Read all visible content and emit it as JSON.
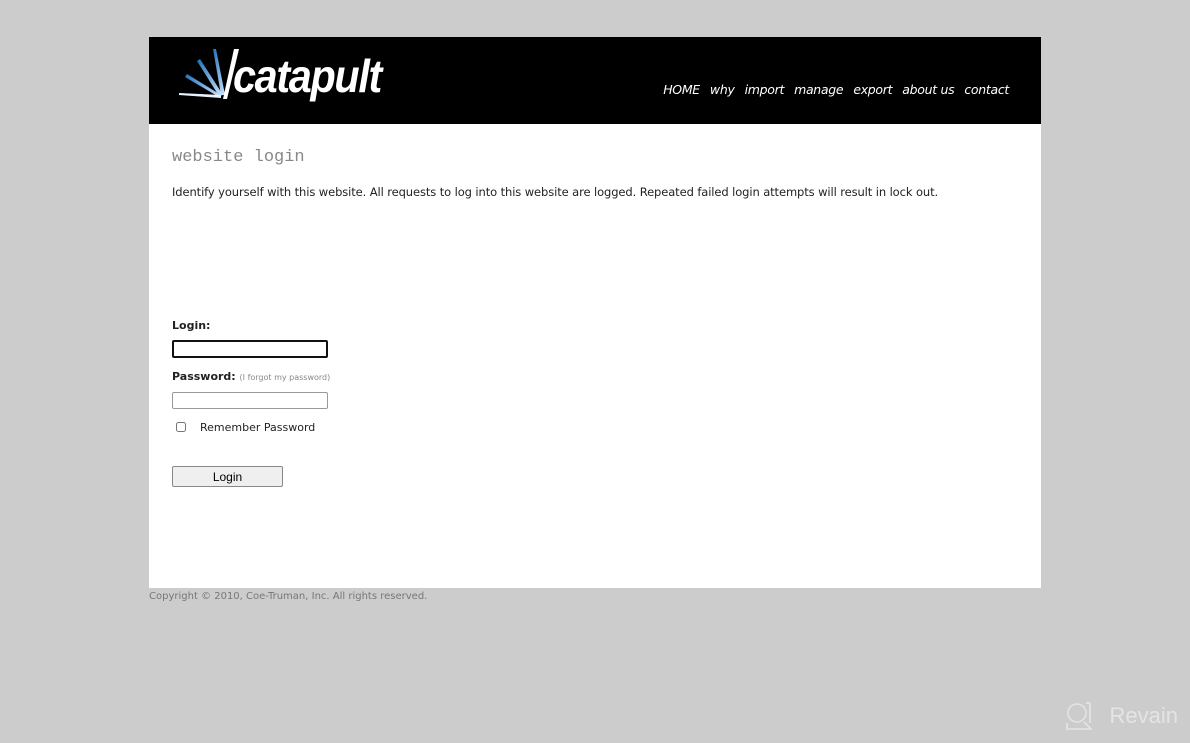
{
  "brand": {
    "name": "catapult",
    "accent": "#3a8fd0"
  },
  "nav": {
    "items": [
      {
        "label": "HOME"
      },
      {
        "label": "why"
      },
      {
        "label": "import"
      },
      {
        "label": "manage"
      },
      {
        "label": "export"
      },
      {
        "label": "about us"
      },
      {
        "label": "contact"
      }
    ]
  },
  "main": {
    "title": "website login",
    "intro": "Identify yourself with this website. All requests to log into this website are logged. Repeated failed login attempts will result in lock out.",
    "form": {
      "login_label": "Login:",
      "login_value": "",
      "password_label": "Password:",
      "forgot_link": "(I forgot my password)",
      "password_value": "",
      "remember_label": "Remember Password",
      "remember_checked": false,
      "submit_label": "Login"
    }
  },
  "footer": {
    "copyright": "Copyright © 2010, Coe-Truman, Inc. All rights reserved."
  },
  "watermark": {
    "text": "Revain"
  }
}
